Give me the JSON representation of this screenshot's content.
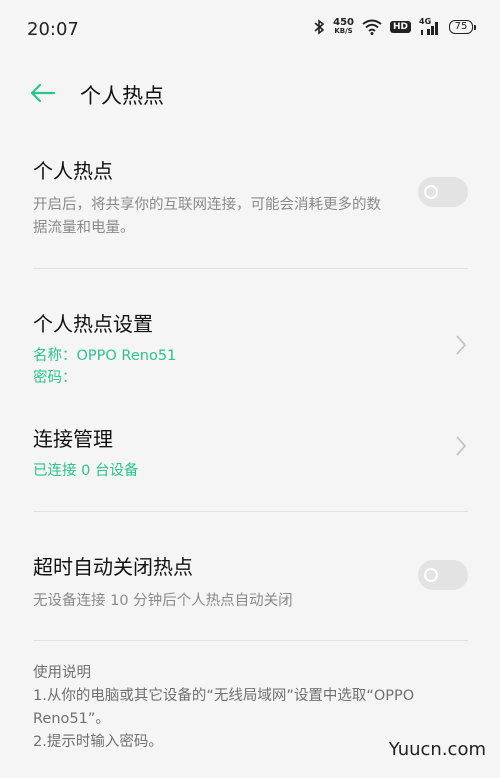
{
  "status": {
    "time": "20:07",
    "speed_value": "450",
    "speed_unit": "KB/S",
    "hd": "HD",
    "network": "4G",
    "battery": "75"
  },
  "header": {
    "title": "个人热点"
  },
  "hotspot": {
    "title": "个人热点",
    "desc": "开启后，将共享你的互联网连接，可能会消耗更多的数据流量和电量。",
    "enabled": false
  },
  "settings": {
    "title": "个人热点设置",
    "name_line": "名称：OPPO Reno51",
    "password_line": "密码："
  },
  "connection": {
    "title": "连接管理",
    "status": "已连接 0 台设备"
  },
  "timeout": {
    "title": "超时自动关闭热点",
    "desc": "无设备连接 10 分钟后个人热点自动关闭",
    "enabled": false
  },
  "instructions": {
    "heading": "使用说明",
    "step1": "1.从你的电脑或其它设备的“无线局域网”设置中选取“OPPO Reno51”。",
    "step2": "2.提示时输入密码。"
  },
  "watermark": "Yuucn.com",
  "icons": [
    "bluetooth-icon",
    "wifi-icon",
    "hd-icon",
    "signal-icon",
    "battery-icon",
    "back-arrow-icon",
    "chevron-right-icon",
    "toggle-switch"
  ],
  "colors": {
    "accent": "#2cc38f",
    "background": "#f5f5f5",
    "toggle_off": "#e3e3e3"
  }
}
